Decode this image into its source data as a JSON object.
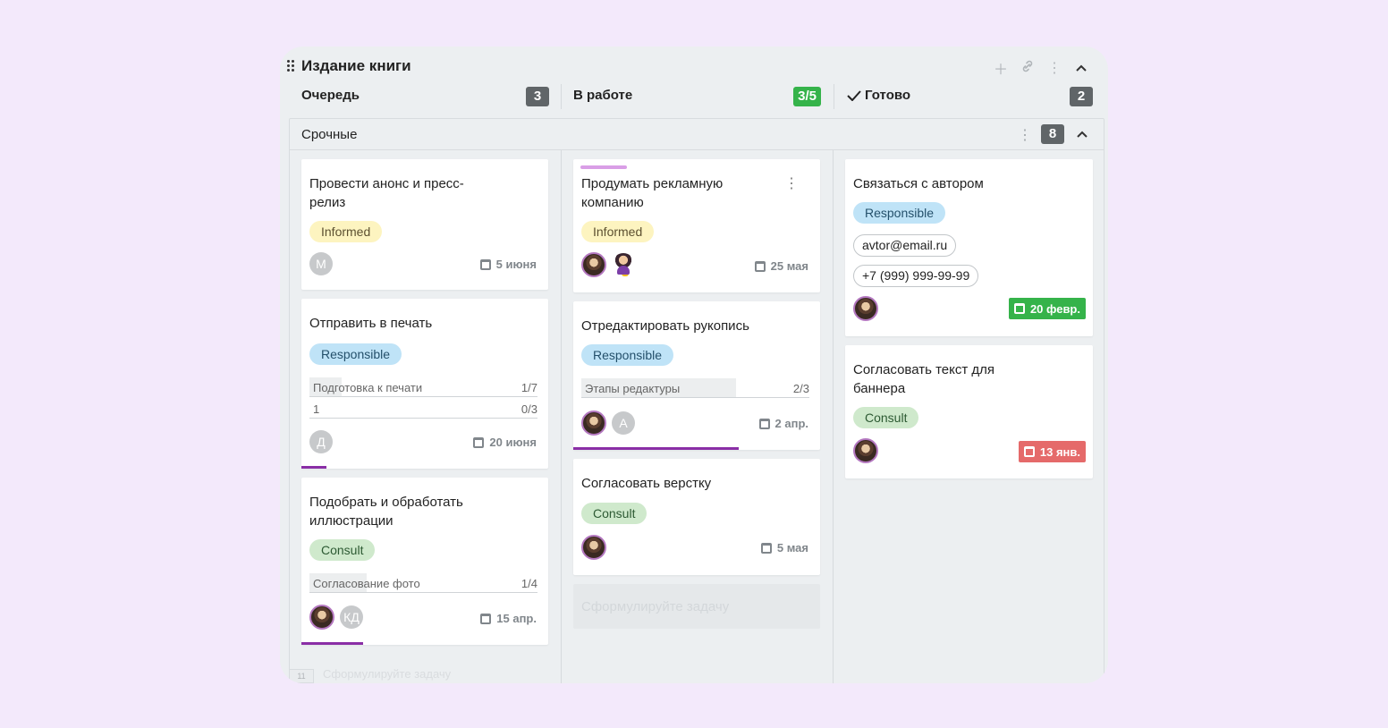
{
  "board": {
    "title": "Издание книги",
    "icons": [
      "plus-icon",
      "link-icon",
      "more-vertical-icon",
      "chevron-up-icon"
    ]
  },
  "columns": [
    {
      "label": "Очередь",
      "count": "3",
      "count_color": "#606568"
    },
    {
      "label": "В работе",
      "count": "3/5",
      "count_color": "#35b34a"
    },
    {
      "label": "Готово",
      "count": "2",
      "count_color": "#606568",
      "check_icon": "checkmark-icon"
    }
  ],
  "swimlane": {
    "label": "Срочные",
    "count": "8"
  },
  "cards": {
    "c1": {
      "title": "Провести анонс и пресс-релиз",
      "tag": "Informed",
      "avatar": "М",
      "date": "5 июня"
    },
    "c2": {
      "title": "Отправить в печать",
      "tag": "Responsible",
      "checklist": [
        {
          "name": "Подготовка к печати",
          "ratio": "1/7"
        },
        {
          "name": "1",
          "ratio": "0/3"
        }
      ],
      "avatar": "Д",
      "date": "20 июня"
    },
    "c3": {
      "title": "Подобрать и обработать иллюстрации",
      "tag": "Consult",
      "checklist": [
        {
          "name": "Согласование фото",
          "ratio": "1/4"
        }
      ],
      "avatar": "КД",
      "date": "15 апр."
    },
    "c4": {
      "title": "Продумать рекламную компанию",
      "tag": "Informed",
      "date": "25 мая"
    },
    "c5": {
      "title": "Отредактировать рукопись",
      "tag": "Responsible",
      "checklist": [
        {
          "name": "Этапы редактуры",
          "ratio": "2/3"
        }
      ],
      "avatar": "А",
      "date": "2 апр."
    },
    "c6": {
      "title": "Согласовать верстку",
      "tag": "Consult",
      "date": "5 мая"
    },
    "c7": {
      "title": "Связаться с автором",
      "tag": "Responsible",
      "email": "avtor@email.ru",
      "phone": "+7 (999) 999-99-99",
      "date": "20 февр."
    },
    "c8": {
      "title": "Согласовать текст для баннера",
      "tag": "Consult",
      "date": "13 янв."
    }
  },
  "placeholders": {
    "new_task": "Сформулируйте задачу",
    "bottom_num": "11",
    "bottom_text": "Сформулируйте задачу"
  },
  "colors": {
    "accent": "#8a2ea6",
    "green": "#35b34a",
    "red": "#e56a6a"
  }
}
